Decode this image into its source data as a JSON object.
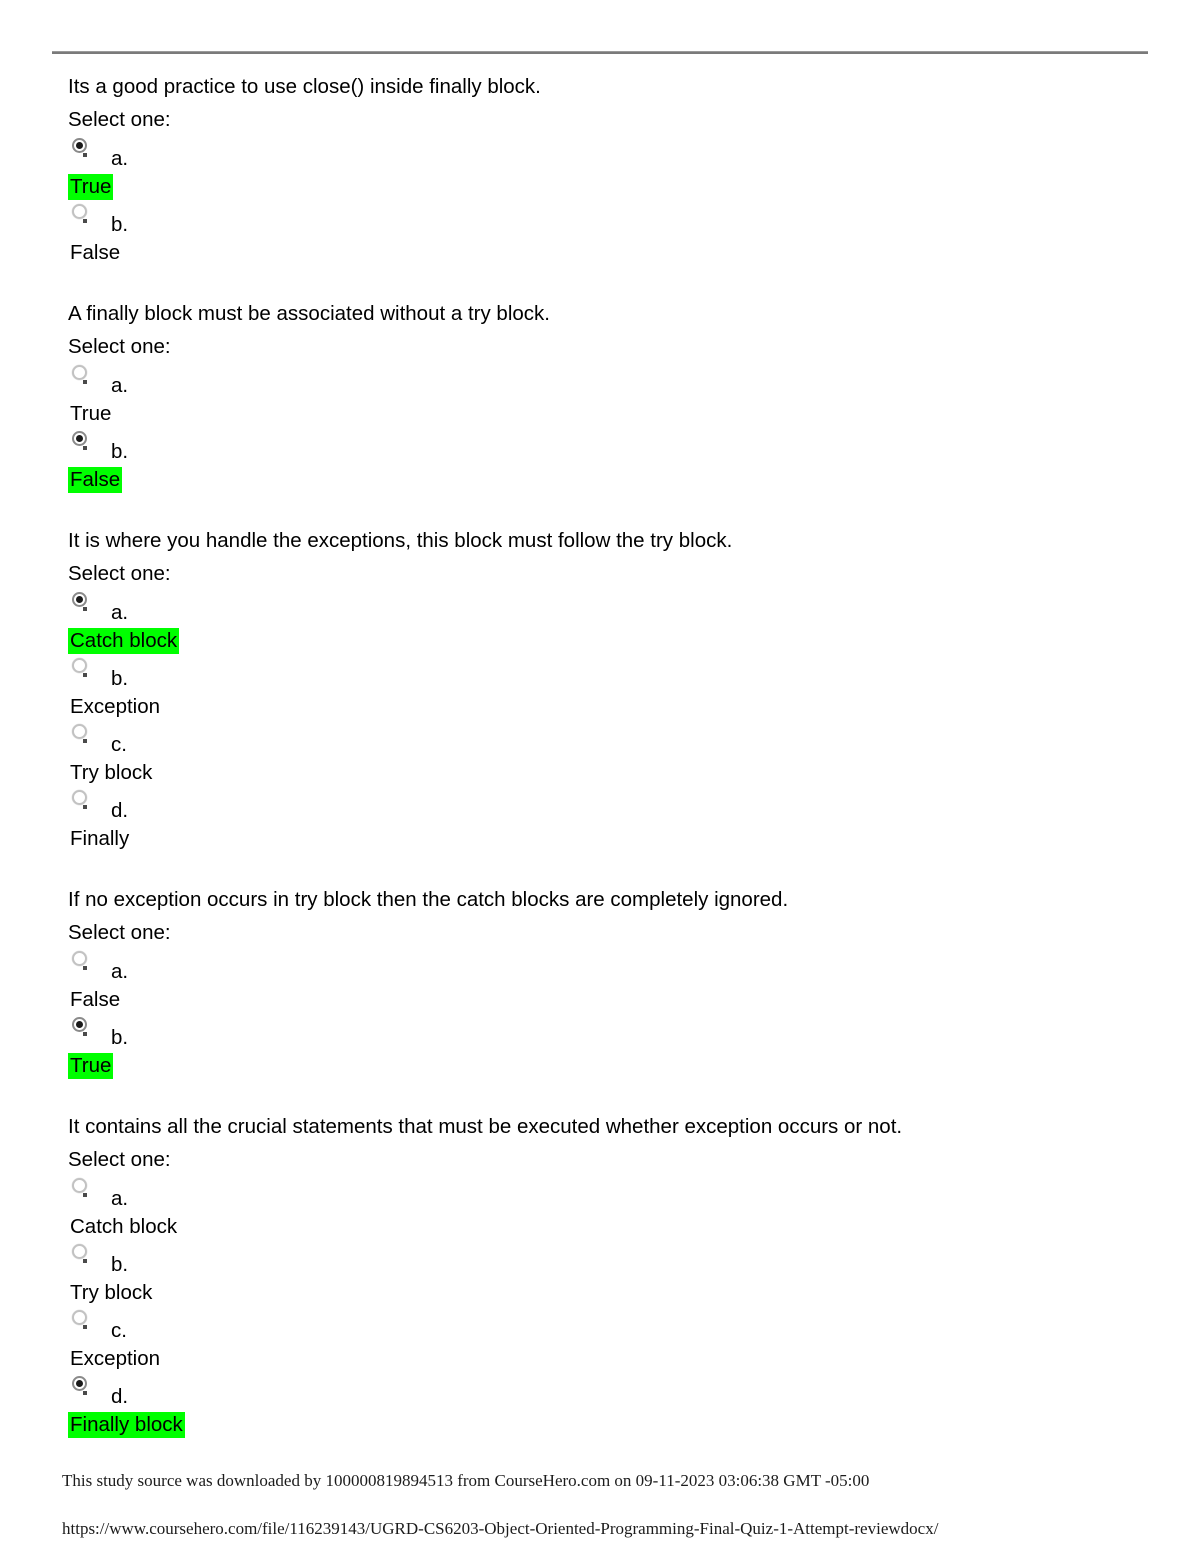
{
  "document": {
    "has_top_rule": true,
    "highlight_color": "#00ff00",
    "select_one_label": "Select one:"
  },
  "questions": [
    {
      "text": "Its a good practice to use close() inside finally block.",
      "select_label": "Select one:",
      "options": [
        {
          "letter": "a.",
          "answer": "True",
          "selected": true,
          "highlighted": true
        },
        {
          "letter": "b.",
          "answer": "False",
          "selected": false,
          "highlighted": false
        }
      ]
    },
    {
      "text": "A finally block must be associated without a try block.",
      "select_label": "Select one:",
      "options": [
        {
          "letter": "a.",
          "answer": "True",
          "selected": false,
          "highlighted": false
        },
        {
          "letter": "b.",
          "answer": "False",
          "selected": true,
          "highlighted": true
        }
      ]
    },
    {
      "text": "It is where you handle the exceptions, this block must follow the try block.",
      "select_label": "Select one:",
      "options": [
        {
          "letter": "a.",
          "answer": "Catch block",
          "selected": true,
          "highlighted": true
        },
        {
          "letter": "b.",
          "answer": "Exception",
          "selected": false,
          "highlighted": false
        },
        {
          "letter": "c.",
          "answer": "Try block",
          "selected": false,
          "highlighted": false
        },
        {
          "letter": "d.",
          "answer": "Finally",
          "selected": false,
          "highlighted": false
        }
      ]
    },
    {
      "text": "If no exception occurs in try block then the catch blocks are completely ignored.",
      "select_label": "Select one:",
      "options": [
        {
          "letter": "a.",
          "answer": "False",
          "selected": false,
          "highlighted": false
        },
        {
          "letter": "b.",
          "answer": "True",
          "selected": true,
          "highlighted": true
        }
      ]
    },
    {
      "text": "It contains all the crucial statements that must be executed whether exception occurs or not.",
      "select_label": "Select one:",
      "options": [
        {
          "letter": "a.",
          "answer": "Catch block",
          "selected": false,
          "highlighted": false
        },
        {
          "letter": "b.",
          "answer": "Try block",
          "selected": false,
          "highlighted": false
        },
        {
          "letter": "c.",
          "answer": "Exception",
          "selected": false,
          "highlighted": false
        },
        {
          "letter": "d.",
          "answer": "Finally block",
          "selected": true,
          "highlighted": true
        }
      ]
    }
  ],
  "footer": {
    "download_note": "This study source was downloaded by 100000819894513 from CourseHero.com on 09-11-2023 03:06:38 GMT -05:00",
    "url": "https://www.coursehero.com/file/116239143/UGRD-CS6203-Object-Oriented-Programming-Final-Quiz-1-Attempt-reviewdocx/"
  }
}
